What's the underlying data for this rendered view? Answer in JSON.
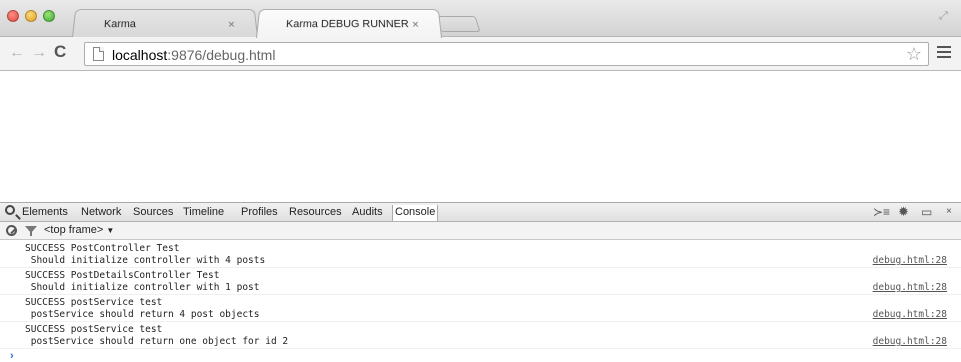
{
  "browser": {
    "tabs": [
      {
        "label": "Karma",
        "active": false
      },
      {
        "label": "Karma DEBUG RUNNER",
        "active": true
      }
    ],
    "tab_close_glyph": "×",
    "url": {
      "host": "localhost",
      "rest": ":9876/debug.html"
    }
  },
  "devtools": {
    "tabs": [
      "Elements",
      "Network",
      "Sources",
      "Timeline",
      "Profiles",
      "Resources",
      "Audits",
      "Console"
    ],
    "selected_tab": "Console",
    "frame": "<top frame>",
    "frame_arrow": "▼",
    "entries": [
      {
        "line1": "SUCCESS PostController Test",
        "line2": " Should initialize controller with 4 posts",
        "source": "debug.html:28"
      },
      {
        "line1": "SUCCESS PostDetailsController Test",
        "line2": " Should initialize controller with 1 post",
        "source": "debug.html:28"
      },
      {
        "line1": "SUCCESS postService test",
        "line2": " postService should return 4 post objects",
        "source": "debug.html:28"
      },
      {
        "line1": "SUCCESS postService test",
        "line2": " postService should return one object for id 2",
        "source": "debug.html:28"
      }
    ],
    "prompt": "›"
  },
  "colors": {
    "accent": "#2a6bd6",
    "close": "#e0443c",
    "minimize": "#dea11f",
    "maximize": "#3ea830"
  }
}
